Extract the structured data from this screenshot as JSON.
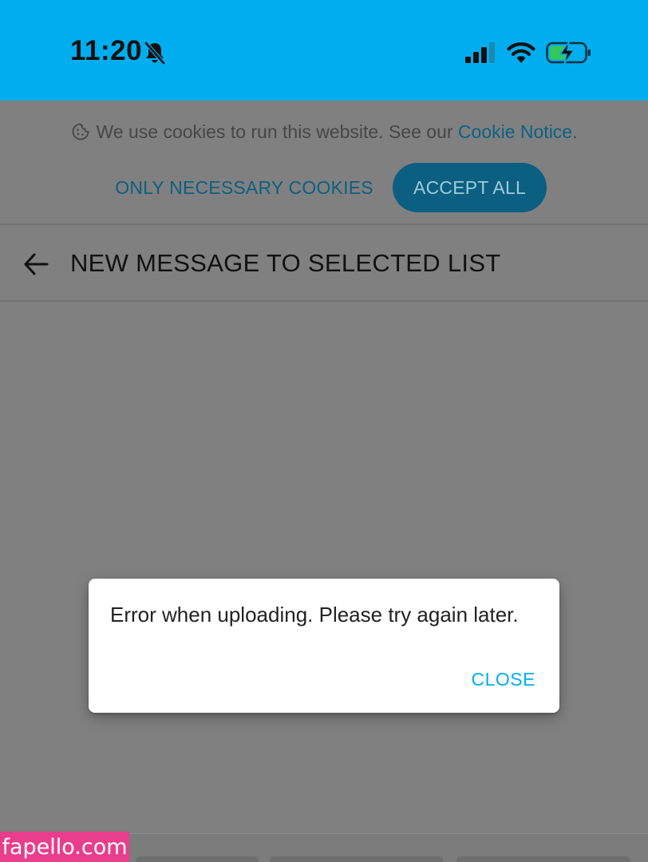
{
  "status_bar": {
    "time": "11:20",
    "background": "#00AEEF",
    "icons": [
      "bell-slash-icon",
      "signal-icon",
      "wifi-icon",
      "battery-charging-icon"
    ]
  },
  "cookie_banner": {
    "text": "We use cookies to run this website. See our ",
    "link_text": "Cookie Notice",
    "text_suffix": ".",
    "only_necessary_label": "ONLY NECESSARY COOKIES",
    "accept_all_label": "ACCEPT ALL",
    "icon": "cookie-icon"
  },
  "header": {
    "title": "NEW MESSAGE TO SELECTED LIST",
    "back_icon": "back-arrow-icon"
  },
  "dialog": {
    "message": "Error when uploading. Please try again later.",
    "close_label": "CLOSE",
    "accent": "#00AEEF"
  },
  "watermark": {
    "text": "fapello.com",
    "color": "#e83e8c"
  }
}
